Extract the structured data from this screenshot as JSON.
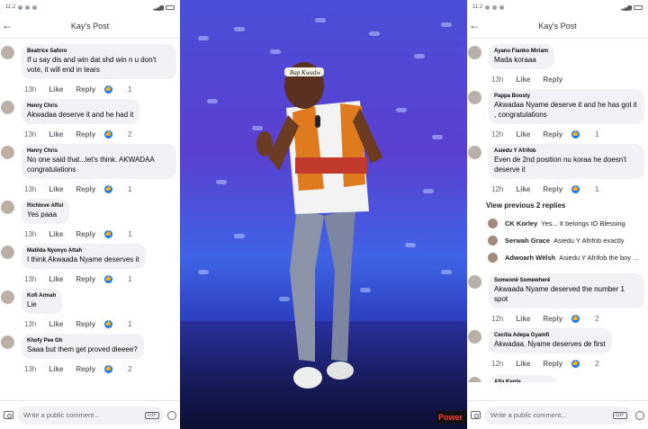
{
  "status_left": {
    "time": "11:2"
  },
  "status_right": {
    "time": "11:2"
  },
  "post_title": "Kay's Post",
  "composer": {
    "placeholder": "Write a public comment...",
    "gif": "GIF"
  },
  "left_comments": [
    {
      "name": "Beatrice Saforo",
      "text": "If u say dis and win dat shd win n u don't vote, it will end in tears",
      "time": "13h",
      "like": "Like",
      "reply": "Reply",
      "reactions": "1"
    },
    {
      "name": "Henry Chris",
      "text": "Akwadaa deserve it and he had it",
      "time": "13h",
      "like": "Like",
      "reply": "Reply",
      "reactions": "2"
    },
    {
      "name": "Henry Chris",
      "text": "No one said that...let's think. AKWADAA congratulations",
      "time": "13h",
      "like": "Like",
      "reply": "Reply",
      "reactions": "1"
    },
    {
      "name": "Richlove Afful",
      "text": "Yes paaa",
      "time": "13h",
      "like": "Like",
      "reply": "Reply",
      "reactions": "1"
    },
    {
      "name": "Matilda Nyonyo Attah",
      "text": "I think Akwaada Nyame deserves it",
      "time": "13h",
      "like": "Like",
      "reply": "Reply",
      "reactions": "1"
    },
    {
      "name": "Kofi Armah",
      "text": "Lie",
      "time": "13h",
      "like": "Like",
      "reply": "Reply",
      "reactions": "1"
    },
    {
      "name": "Khofy Pee Gh",
      "text": "Saaa but them get proved dieeee?",
      "time": "13h",
      "like": "Like",
      "reply": "Reply",
      "reactions": "2"
    }
  ],
  "right_comments_top": [
    {
      "name": "Ayanu Fianko Miriam",
      "text": "Mada koraaa",
      "time": "13h",
      "like": "Like",
      "reply": "Reply",
      "reactions": ""
    },
    {
      "name": "Pappa Boosty",
      "text": "Akwadaa Nyame deserve it and he has got it , congratulations",
      "time": "12h",
      "like": "Like",
      "reply": "Reply",
      "reactions": "1"
    },
    {
      "name": "Asiedu Y Afrifob",
      "text": "Even de 2nd position nu koraa he doesn't deserve it",
      "time": "12h",
      "like": "Like",
      "reply": "Reply",
      "reactions": "1"
    }
  ],
  "view_previous": "View previous 2 replies",
  "replies": [
    {
      "name": "CK Korley",
      "text": "Yes... It belongs tO Blessing"
    },
    {
      "name": "Serwah Grace",
      "text": "Asiedu Y Afrifob exactly"
    },
    {
      "name": "Adwoarh Wëlsh",
      "text": "Asiedu Y Afrifob the boy ..."
    }
  ],
  "right_comments_bottom": [
    {
      "name": "Someonë Somewherë",
      "text": "Akwaada Nyame deserved the number 1 spot",
      "time": "12h",
      "like": "Like",
      "reply": "Reply",
      "reactions": "2"
    },
    {
      "name": "Cecilia Adepa Gyamfi",
      "text": "Akwadaa. Nyame deserves de first",
      "time": "12h",
      "like": "Like",
      "reply": "Reply",
      "reactions": "2"
    },
    {
      "name": "Afia Kente",
      "text": "Raymond Nyarko",
      "time": "",
      "like": "",
      "reply": "",
      "reactions": ""
    }
  ],
  "photo": {
    "headband": "Rap Kwadw",
    "logo": "Power"
  },
  "colors": {
    "facebook_blue": "#1877f2",
    "bubble": "#f0f2f5",
    "muted": "#65676b"
  }
}
